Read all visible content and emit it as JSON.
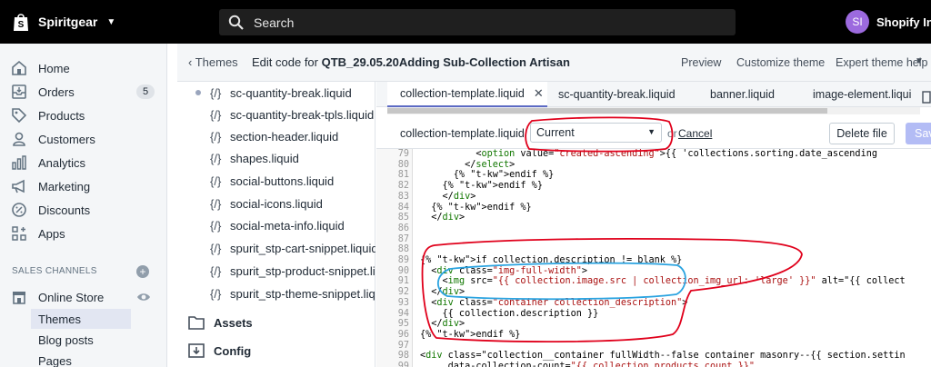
{
  "topbar": {
    "store_name": "Spiritgear",
    "search_placeholder": "Search",
    "avatar_initials": "SI",
    "user_name": "Shopify Inst"
  },
  "sidebar": {
    "items": [
      {
        "label": "Home",
        "icon": "home-icon"
      },
      {
        "label": "Orders",
        "icon": "orders-icon",
        "badge": "5"
      },
      {
        "label": "Products",
        "icon": "tag-icon"
      },
      {
        "label": "Customers",
        "icon": "person-icon"
      },
      {
        "label": "Analytics",
        "icon": "bar-chart-icon"
      },
      {
        "label": "Marketing",
        "icon": "megaphone-icon"
      },
      {
        "label": "Discounts",
        "icon": "discount-icon"
      },
      {
        "label": "Apps",
        "icon": "apps-icon"
      }
    ],
    "sales_channels_label": "SALES CHANNELS",
    "online_store_label": "Online Store",
    "sub_items": [
      "Themes",
      "Blog posts",
      "Pages"
    ]
  },
  "header": {
    "back_label": "Themes",
    "title_prefix": "Edit code for ",
    "title_theme": "QTB_29.05.20Adding Sub-Collection Artisan",
    "preview_label": "Preview",
    "customize_label": "Customize theme",
    "expert_help_label": "Expert theme help"
  },
  "files": [
    "sc-quantity-break.liquid",
    "sc-quantity-break-tpls.liquid",
    "section-header.liquid",
    "shapes.liquid",
    "social-buttons.liquid",
    "social-icons.liquid",
    "social-meta-info.liquid",
    "spurit_stp-cart-snippet.liquid",
    "spurit_stp-product-snippet.liquid",
    "spurit_stp-theme-snippet.liquid"
  ],
  "file_icon_text": "{/}",
  "folders": [
    "Assets",
    "Config"
  ],
  "tabs": [
    {
      "label": "collection-template.liquid",
      "active": true
    },
    {
      "label": "sc-quantity-break.liquid"
    },
    {
      "label": "banner.liquid"
    },
    {
      "label": "image-element.liqui"
    }
  ],
  "editor": {
    "filename": "collection-template.liquid",
    "version_select": "Current",
    "or_text": "or",
    "cancel_label": "Cancel",
    "delete_label": "Delete file",
    "save_label": "Save"
  },
  "code_lines": [
    {
      "n": "79",
      "t": "          <option value=\"created-ascending\">{{ 'collections.sorting.date_ascending"
    },
    {
      "n": "80",
      "t": "        </select>"
    },
    {
      "n": "81",
      "t": "      {% endif %}"
    },
    {
      "n": "82",
      "t": "    {% endif %}"
    },
    {
      "n": "83",
      "t": "    </div>"
    },
    {
      "n": "84",
      "t": "  {% endif %}"
    },
    {
      "n": "85",
      "t": "  </div>"
    },
    {
      "n": "86",
      "t": ""
    },
    {
      "n": "87",
      "t": ""
    },
    {
      "n": "88",
      "t": ""
    },
    {
      "n": "89",
      "t": "{% if collection.description != blank %}"
    },
    {
      "n": "90",
      "t": "  <div class=\"img-full-width\">"
    },
    {
      "n": "91",
      "t": "    <img src=\"{{ collection.image.src | collection_img_url: 'large' }}\" alt=\"{{ collect"
    },
    {
      "n": "92",
      "t": "  </div>"
    },
    {
      "n": "93",
      "t": "  <div class=\"container collection_description\">"
    },
    {
      "n": "94",
      "t": "    {{ collection.description }}"
    },
    {
      "n": "95",
      "t": "  </div>"
    },
    {
      "n": "96",
      "t": "{% endif %}"
    },
    {
      "n": "97",
      "t": ""
    },
    {
      "n": "98",
      "t": "<div class=\"collection__container fullWidth--false container masonry--{{ section.settin"
    },
    {
      "n": "99",
      "t": "     data-collection-count=\"{{ collection.products_count }}\""
    }
  ],
  "colors": {
    "topbar": "#000000",
    "sidebar": "#f4f6f8",
    "accent": "#5c6ac4",
    "annotation_red": "#e0001b",
    "annotation_blue": "#2aa3e0"
  }
}
